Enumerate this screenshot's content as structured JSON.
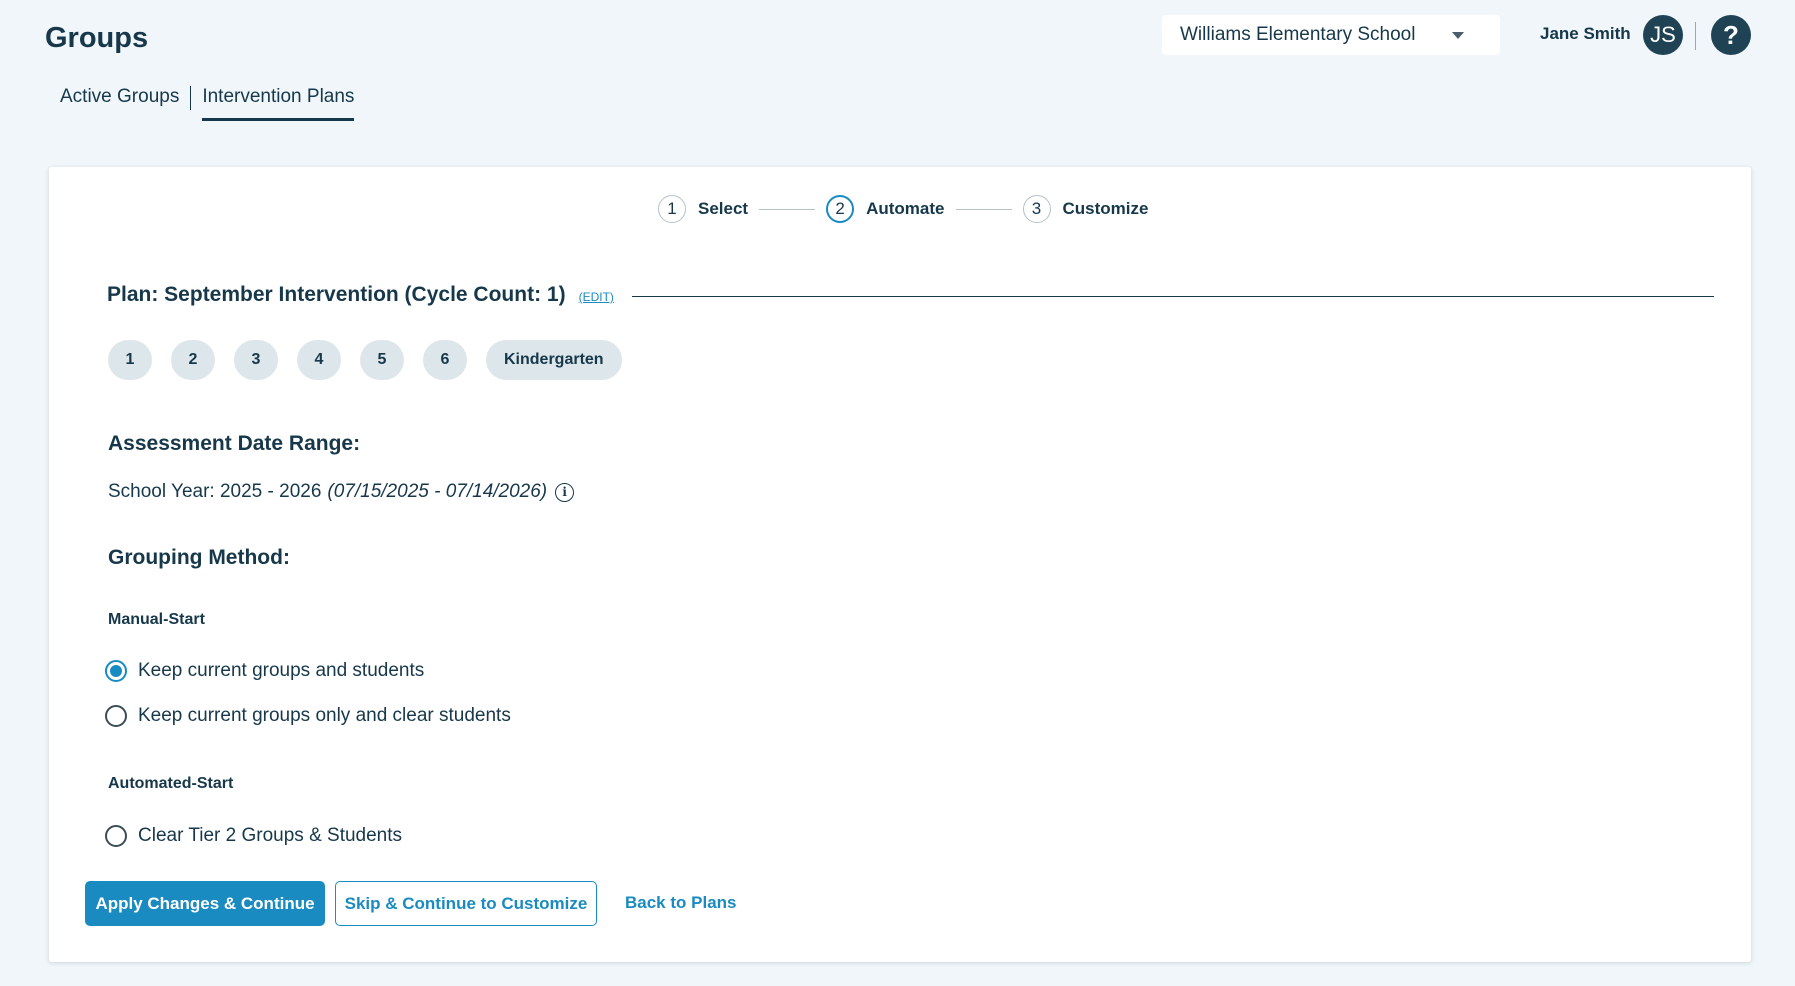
{
  "header": {
    "page_title": "Groups",
    "school_selector": {
      "value": "Williams Elementary School",
      "icon": "chevron-down-icon"
    },
    "user": {
      "name": "Jane Smith",
      "initials": "JS"
    },
    "help": {
      "label": "?",
      "icon": "help-icon"
    }
  },
  "tabs": [
    {
      "label": "Active Groups",
      "active": false
    },
    {
      "label": "Intervention Plans",
      "active": true
    }
  ],
  "stepper": [
    {
      "number": "1",
      "label": "Select",
      "current": false
    },
    {
      "number": "2",
      "label": "Automate",
      "current": true
    },
    {
      "number": "3",
      "label": "Customize",
      "current": false
    }
  ],
  "plan": {
    "title": "Plan: September Intervention (Cycle Count: 1)",
    "edit_label": "(EDIT)"
  },
  "grades": [
    "1",
    "2",
    "3",
    "4",
    "5",
    "6",
    "Kindergarten"
  ],
  "assessment": {
    "heading": "Assessment Date Range:",
    "school_year": "School Year: 2025 - 2026",
    "date_range": "(07/15/2025 - 07/14/2026)",
    "info_icon": "info-icon"
  },
  "grouping": {
    "heading": "Grouping Method:",
    "manual_heading": "Manual-Start",
    "manual_options": [
      {
        "label": "Keep current groups and students",
        "checked": true
      },
      {
        "label": "Keep current groups only and clear students",
        "checked": false
      }
    ],
    "automated_heading": "Automated-Start",
    "automated_options": [
      {
        "label": "Clear Tier 2 Groups & Students",
        "checked": false
      }
    ]
  },
  "actions": {
    "primary": "Apply Changes & Continue",
    "secondary": "Skip & Continue to Customize",
    "link": "Back to Plans"
  },
  "colors": {
    "accent": "#1a8bc0",
    "text": "#17384a",
    "background": "#f0f6f9",
    "pill": "#dde6ea"
  }
}
